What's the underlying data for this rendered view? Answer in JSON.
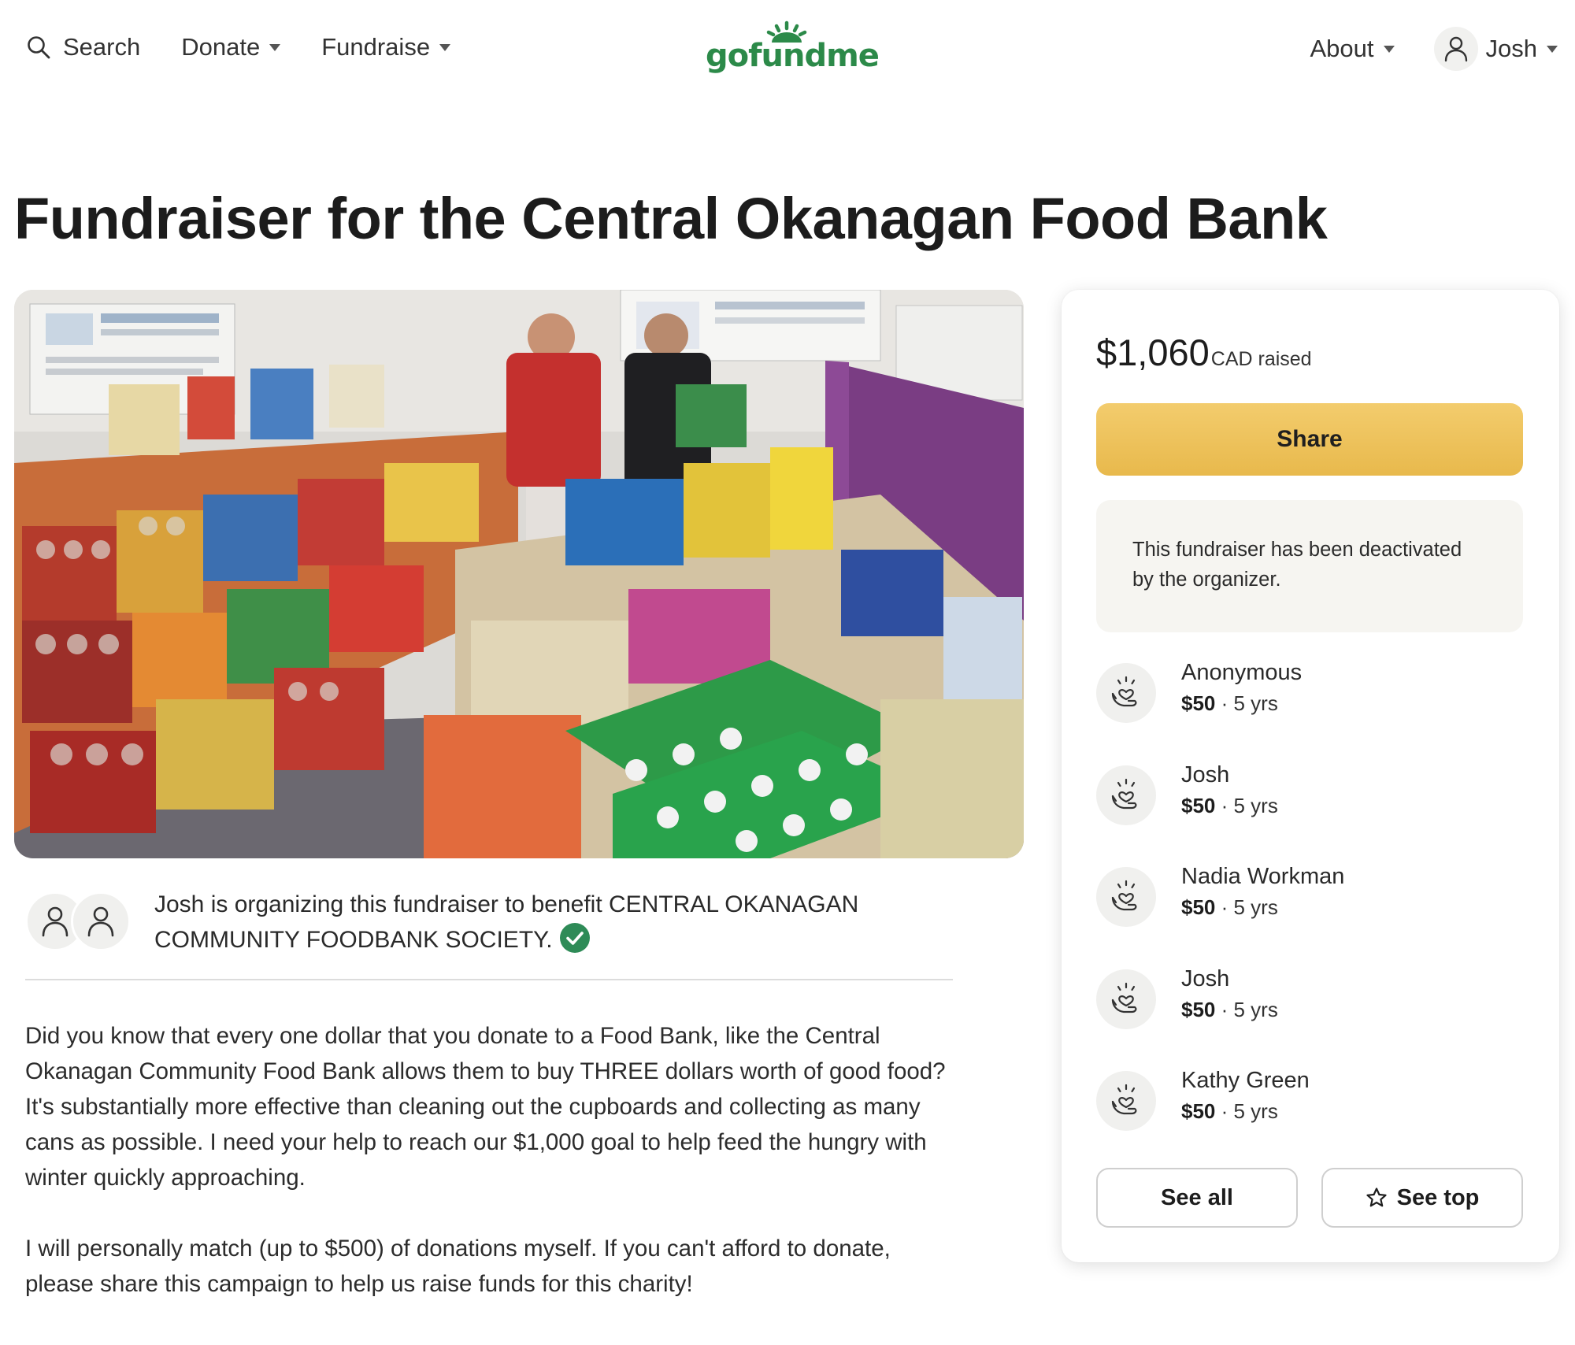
{
  "header": {
    "search_label": "Search",
    "donate_label": "Donate",
    "fundraise_label": "Fundraise",
    "logo_text": "gofundme",
    "about_label": "About",
    "user_name": "Josh"
  },
  "page": {
    "title": "Fundraiser for the Central Okanagan Food Bank"
  },
  "organizer": {
    "text": "Josh is organizing this fundraiser to benefit CENTRAL OKANAGAN COMMUNITY FOODBANK SOCIETY."
  },
  "description": {
    "paragraphs": [
      "Did you know that every one dollar that you donate to a Food Bank, like the Central Okanagan Community Food Bank allows them to buy THREE dollars worth of good food? It's substantially more effective than cleaning out the cupboards and collecting as many cans as possible. I need your help to reach our $1,000 goal to help feed the hungry with winter quickly approaching.",
      "I will personally match (up to $500) of donations myself. If you can't afford to donate, please share this campaign to help us raise funds for this charity!"
    ]
  },
  "sidebar": {
    "amount_raised": "$1,060",
    "currency_label": "CAD raised",
    "share_label": "Share",
    "notice": "This fundraiser has been deactivated by the organizer.",
    "donations": [
      {
        "name": "Anonymous",
        "amount": "$50",
        "time": "5 yrs"
      },
      {
        "name": "Josh",
        "amount": "$50",
        "time": "5 yrs"
      },
      {
        "name": "Nadia Workman",
        "amount": "$50",
        "time": "5 yrs"
      },
      {
        "name": "Josh",
        "amount": "$50",
        "time": "5 yrs"
      },
      {
        "name": "Kathy Green",
        "amount": "$50",
        "time": "5 yrs"
      }
    ],
    "see_all_label": "See all",
    "see_top_label": "See top"
  },
  "colors": {
    "brand_green": "#2c8a49",
    "share_button": "#eabf55",
    "verified_green": "#2e8b57",
    "notice_bg": "#f6f5f1"
  },
  "icons": [
    "search-icon",
    "caret-down-icon",
    "user-icon",
    "verified-check-icon",
    "heart-hands-icon",
    "star-icon"
  ]
}
